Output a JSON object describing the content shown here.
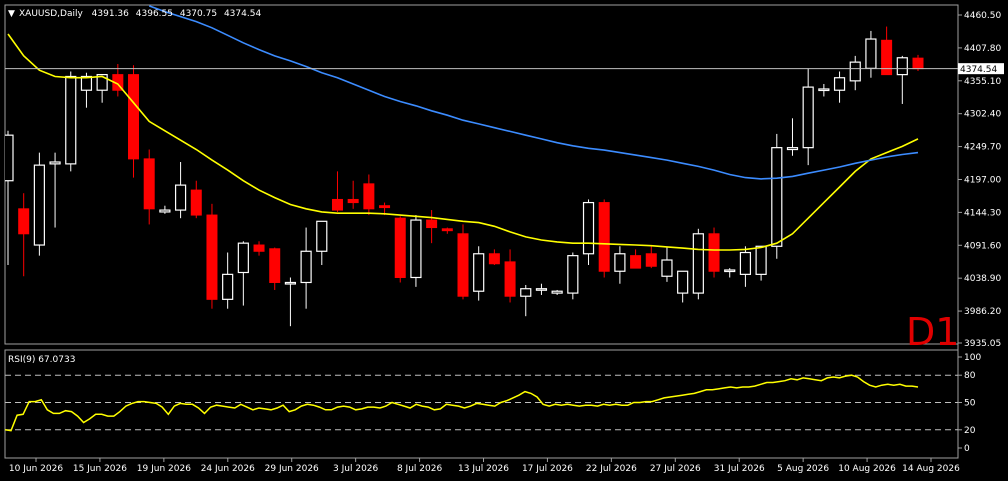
{
  "header": {
    "symbol": "XAUUSD",
    "timeframe": "Daily",
    "open": "4391.36",
    "high": "4396.55",
    "low": "4370.75",
    "close": "4374.54"
  },
  "timeframe_badge": "D1",
  "current_price_label": "4374.54",
  "colors": {
    "background": "#000000",
    "bull": "#ffffff",
    "bear": "#ff0000",
    "ma_fast": "#ffff00",
    "ma_slow": "#3c8cff",
    "rsi": "#ffff00",
    "grid_line": "#c0c0c0",
    "badge": "#e00000"
  },
  "chart_data": [
    {
      "type": "candlestick",
      "title": "XAUUSD,Daily",
      "ylim": [
        3935.05,
        4460.5
      ],
      "y_ticks": [
        "4460.50",
        "4407.80",
        "4355.10",
        "4302.40",
        "4249.70",
        "4197.00",
        "4144.30",
        "4091.60",
        "4038.90",
        "3986.20",
        "3935.05"
      ],
      "x_ticks": [
        "10 Jun 2026",
        "15 Jun 2026",
        "19 Jun 2026",
        "24 Jun 2026",
        "29 Jun 2026",
        "3 Jul 2026",
        "8 Jul 2026",
        "13 Jul 2026",
        "17 Jul 2026",
        "22 Jul 2026",
        "27 Jul 2026",
        "31 Jul 2026",
        "5 Aug 2026",
        "10 Aug 2026",
        "14 Aug 2026"
      ],
      "candles": [
        {
          "o": 4195,
          "h": 4275,
          "l": 4060,
          "c": 4268
        },
        {
          "o": 4150,
          "h": 4175,
          "l": 4042,
          "c": 4110
        },
        {
          "o": 4092,
          "h": 4240,
          "l": 4075,
          "c": 4220
        },
        {
          "o": 4222,
          "h": 4240,
          "l": 4120,
          "c": 4225
        },
        {
          "o": 4222,
          "h": 4370,
          "l": 4210,
          "c": 4362
        },
        {
          "o": 4340,
          "h": 4368,
          "l": 4312,
          "c": 4362
        },
        {
          "o": 4340,
          "h": 4366,
          "l": 4320,
          "c": 4365
        },
        {
          "o": 4365,
          "h": 4382,
          "l": 4330,
          "c": 4340
        },
        {
          "o": 4365,
          "h": 4380,
          "l": 4200,
          "c": 4230
        },
        {
          "o": 4230,
          "h": 4245,
          "l": 4125,
          "c": 4150
        },
        {
          "o": 4145,
          "h": 4155,
          "l": 4142,
          "c": 4148
        },
        {
          "o": 4148,
          "h": 4225,
          "l": 4135,
          "c": 4188
        },
        {
          "o": 4180,
          "h": 4195,
          "l": 4135,
          "c": 4140
        },
        {
          "o": 4140,
          "h": 4158,
          "l": 3990,
          "c": 4005
        },
        {
          "o": 4005,
          "h": 4080,
          "l": 3990,
          "c": 4045
        },
        {
          "o": 4048,
          "h": 4098,
          "l": 3995,
          "c": 4095
        },
        {
          "o": 4092,
          "h": 4098,
          "l": 4075,
          "c": 4082
        },
        {
          "o": 4086,
          "h": 4088,
          "l": 4020,
          "c": 4032
        },
        {
          "o": 4032,
          "h": 4040,
          "l": 3962,
          "c": 4032
        },
        {
          "o": 4032,
          "h": 4120,
          "l": 3990,
          "c": 4082
        },
        {
          "o": 4082,
          "h": 4128,
          "l": 4060,
          "c": 4130
        },
        {
          "o": 4165,
          "h": 4210,
          "l": 4145,
          "c": 4148
        },
        {
          "o": 4165,
          "h": 4195,
          "l": 4150,
          "c": 4160
        },
        {
          "o": 4190,
          "h": 4205,
          "l": 4140,
          "c": 4150
        },
        {
          "o": 4155,
          "h": 4160,
          "l": 4140,
          "c": 4152
        },
        {
          "o": 4135,
          "h": 4138,
          "l": 4032,
          "c": 4040
        },
        {
          "o": 4040,
          "h": 4140,
          "l": 4025,
          "c": 4132
        },
        {
          "o": 4132,
          "h": 4148,
          "l": 4095,
          "c": 4120
        },
        {
          "o": 4118,
          "h": 4120,
          "l": 4110,
          "c": 4115
        },
        {
          "o": 4110,
          "h": 4125,
          "l": 4005,
          "c": 4010
        },
        {
          "o": 4018,
          "h": 4090,
          "l": 4003,
          "c": 4078
        },
        {
          "o": 4078,
          "h": 4085,
          "l": 4060,
          "c": 4062
        },
        {
          "o": 4065,
          "h": 4085,
          "l": 4000,
          "c": 4010
        },
        {
          "o": 4010,
          "h": 4028,
          "l": 3978,
          "c": 4022
        },
        {
          "o": 4020,
          "h": 4030,
          "l": 4012,
          "c": 4022
        },
        {
          "o": 4015,
          "h": 4020,
          "l": 4012,
          "c": 4018
        },
        {
          "o": 4015,
          "h": 4080,
          "l": 4005,
          "c": 4075
        },
        {
          "o": 4078,
          "h": 4165,
          "l": 4060,
          "c": 4160
        },
        {
          "o": 4160,
          "h": 4165,
          "l": 4040,
          "c": 4050
        },
        {
          "o": 4050,
          "h": 4090,
          "l": 4030,
          "c": 4078
        },
        {
          "o": 4075,
          "h": 4085,
          "l": 4055,
          "c": 4055
        },
        {
          "o": 4078,
          "h": 4090,
          "l": 4055,
          "c": 4058
        },
        {
          "o": 4042,
          "h": 4088,
          "l": 4033,
          "c": 4068
        },
        {
          "o": 4015,
          "h": 4050,
          "l": 4000,
          "c": 4050
        },
        {
          "o": 4015,
          "h": 4118,
          "l": 4005,
          "c": 4110
        },
        {
          "o": 4110,
          "h": 4120,
          "l": 4040,
          "c": 4050
        },
        {
          "o": 4050,
          "h": 4055,
          "l": 4040,
          "c": 4052
        },
        {
          "o": 4045,
          "h": 4090,
          "l": 4025,
          "c": 4080
        },
        {
          "o": 4045,
          "h": 4085,
          "l": 4035,
          "c": 4090
        },
        {
          "o": 4090,
          "h": 4270,
          "l": 4070,
          "c": 4248
        },
        {
          "o": 4245,
          "h": 4295,
          "l": 4235,
          "c": 4248
        },
        {
          "o": 4248,
          "h": 4375,
          "l": 4220,
          "c": 4345
        },
        {
          "o": 4340,
          "h": 4350,
          "l": 4330,
          "c": 4342
        },
        {
          "o": 4340,
          "h": 4370,
          "l": 4320,
          "c": 4360
        },
        {
          "o": 4355,
          "h": 4395,
          "l": 4340,
          "c": 4385
        },
        {
          "o": 4375,
          "h": 4435,
          "l": 4360,
          "c": 4422
        },
        {
          "o": 4420,
          "h": 4442,
          "l": 4370,
          "c": 4365
        },
        {
          "o": 4365,
          "h": 4395,
          "l": 4318,
          "c": 4392
        },
        {
          "o": 4391.36,
          "h": 4396.55,
          "l": 4370.75,
          "c": 4374.54
        }
      ],
      "series": [
        {
          "values": [
            4430,
            4395,
            4372,
            4362,
            4360,
            4360,
            4362,
            4350,
            4320,
            4290,
            4275,
            4260,
            4245,
            4228,
            4212,
            4195,
            4180,
            4168,
            4157,
            4150,
            4145,
            4143,
            4143,
            4143,
            4142,
            4140,
            4138,
            4136,
            4133,
            4130,
            4128,
            4122,
            4113,
            4105,
            4100,
            4097,
            4095,
            4095,
            4094,
            4093,
            4092,
            4091,
            4089,
            4087,
            4085,
            4084,
            4084,
            4085,
            4088,
            4095,
            4110,
            4135,
            4160,
            4185,
            4210,
            4230,
            4240,
            4250,
            4262
          ]
        },
        {
          "values": [
            null,
            null,
            null,
            null,
            null,
            null,
            null,
            null,
            null,
            4475,
            4466,
            4458,
            4450,
            4440,
            4428,
            4416,
            4405,
            4395,
            4387,
            4378,
            4368,
            4360,
            4350,
            4340,
            4330,
            4322,
            4315,
            4307,
            4300,
            4292,
            4286,
            4280,
            4274,
            4268,
            4262,
            4256,
            4251,
            4247,
            4244,
            4240,
            4236,
            4232,
            4228,
            4223,
            4218,
            4212,
            4205,
            4200,
            4198,
            4199,
            4202,
            4207,
            4212,
            4217,
            4223,
            4228,
            4233,
            4237,
            4240
          ]
        }
      ]
    },
    {
      "type": "line",
      "title": "RSI(9) 67.0733",
      "ylim": [
        0,
        100
      ],
      "y_ticks": [
        "100",
        "80",
        "50",
        "20",
        "0"
      ],
      "levels": [
        80,
        50,
        20
      ],
      "values": [
        20,
        19,
        36,
        37,
        51,
        51,
        53,
        42,
        38,
        38,
        41,
        40,
        35,
        28,
        32,
        37,
        37,
        35,
        35,
        40,
        46,
        49,
        51,
        51,
        50,
        49,
        45,
        37,
        46,
        49,
        48,
        48,
        44,
        38,
        45,
        47,
        46,
        45,
        44,
        48,
        45,
        42,
        44,
        43,
        42,
        44,
        47,
        40,
        42,
        46,
        48,
        47,
        45,
        42,
        42,
        45,
        46,
        45,
        42,
        43,
        45,
        45,
        44,
        46,
        50,
        48,
        46,
        44,
        48,
        46,
        45,
        42,
        43,
        48,
        47,
        46,
        44,
        46,
        49,
        48,
        47,
        46,
        50,
        52,
        55,
        58,
        62,
        60,
        56,
        48,
        46,
        48,
        47,
        48,
        47,
        46,
        47,
        47,
        46,
        48,
        47,
        48,
        47,
        47,
        50,
        50,
        51,
        51,
        53,
        55,
        56,
        57,
        58,
        59,
        60,
        62,
        64,
        64,
        65,
        66,
        67,
        66,
        67,
        67,
        68,
        70,
        72,
        72,
        73,
        74,
        76,
        75,
        77,
        76,
        75,
        74,
        77,
        78,
        77,
        79,
        80,
        78,
        73,
        69,
        67,
        69,
        70,
        69,
        70,
        68,
        68,
        67
      ]
    }
  ]
}
